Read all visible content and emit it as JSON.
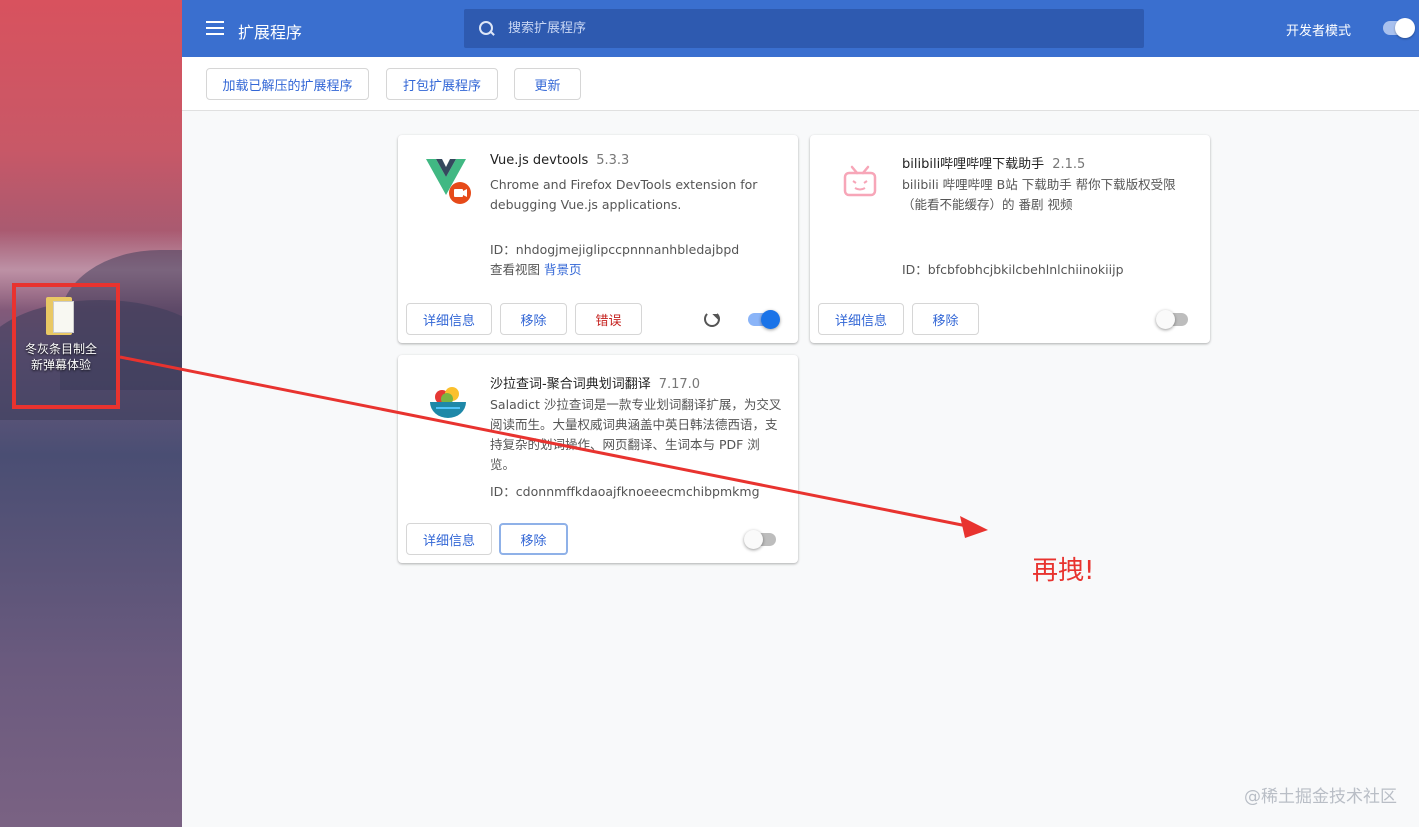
{
  "desktop": {
    "icon_label_line1": "冬灰条目制全",
    "icon_label_line2": "新弹幕体验"
  },
  "header": {
    "title": "扩展程序",
    "search_placeholder": "搜索扩展程序",
    "dev_mode_label": "开发者模式",
    "dev_mode_on": true
  },
  "toolbar": {
    "load_unpacked": "加载已解压的扩展程序",
    "pack": "打包扩展程序",
    "update": "更新"
  },
  "extensions": [
    {
      "name": "Vue.js devtools",
      "version": "5.3.3",
      "description": "Chrome and Firefox DevTools extension for debugging Vue.js applications.",
      "id": "ID：nhdogjmejiglipccpnnnanhbledajbpd",
      "views_label": "查看视图",
      "views_link": "背景页",
      "details": "详细信息",
      "remove": "移除",
      "errors": "错误",
      "enabled": true
    },
    {
      "name": "bilibili哔哩哔哩下载助手",
      "version": "2.1.5",
      "description": "bilibili 哔哩哔哩 B站 下载助手 帮你下载版权受限（能看不能缓存）的 番剧 视频",
      "id": "ID：bfcbfobhcjbkilcbehlnlchiinokiijp",
      "details": "详细信息",
      "remove": "移除",
      "enabled": false
    },
    {
      "name": "沙拉查词-聚合词典划词翻译",
      "version": "7.17.0",
      "description": "Saladict 沙拉查词是一款专业划词翻译扩展，为交叉阅读而生。大量权威词典涵盖中英日韩法德西语，支持复杂的划词操作、网页翻译、生词本与 PDF 浏览。",
      "id": "ID：cdonnmffkdaoajfknoeeecmchibpmkmg",
      "details": "详细信息",
      "remove": "移除",
      "enabled": false
    }
  ],
  "annotation": {
    "text": "再拽!",
    "color": "#e8332f"
  },
  "watermark": "@稀土掘金技术社区",
  "colors": {
    "header_bg": "#3a6fcf",
    "accent": "#3367d6",
    "toggle_on": "#1a73e8"
  }
}
